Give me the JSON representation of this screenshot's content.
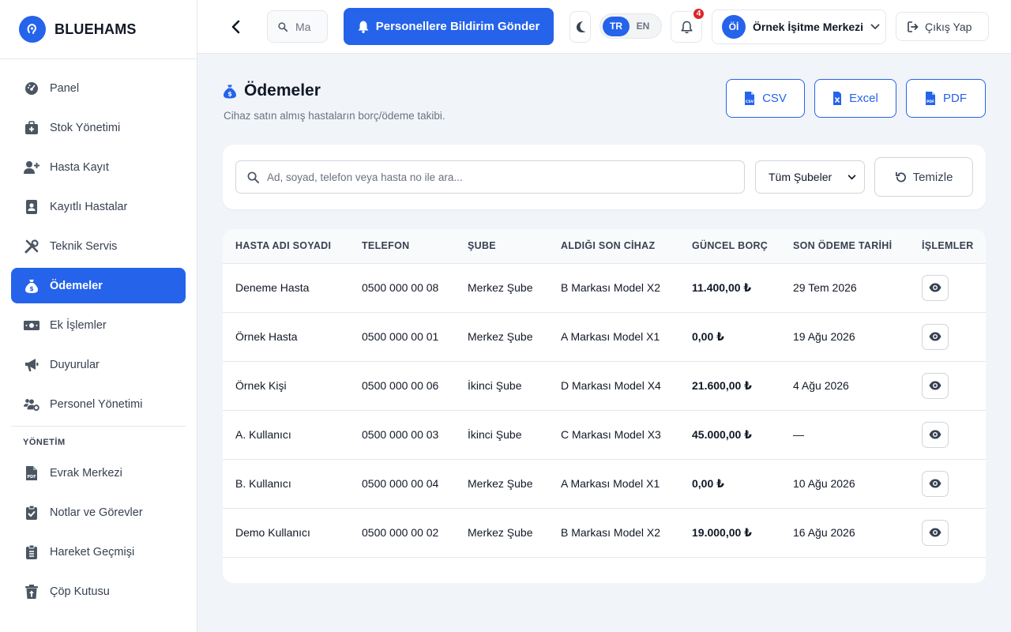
{
  "brand": {
    "name": "BLUEHAMS"
  },
  "sidebar": {
    "items": [
      {
        "label": "Panel",
        "icon": "gauge-icon"
      },
      {
        "label": "Stok Yönetimi",
        "icon": "briefcase-medical-icon"
      },
      {
        "label": "Hasta Kayıt",
        "icon": "user-plus-icon"
      },
      {
        "label": "Kayıtlı Hastalar",
        "icon": "address-book-icon"
      },
      {
        "label": "Teknik Servis",
        "icon": "tools-icon"
      },
      {
        "label": "Ödemeler",
        "icon": "money-bag-icon",
        "active": true
      },
      {
        "label": "Ek İşlemler",
        "icon": "money-bill-icon"
      },
      {
        "label": "Duyurular",
        "icon": "megaphone-icon"
      },
      {
        "label": "Personel Yönetimi",
        "icon": "users-cog-icon"
      }
    ],
    "section_label": "YÖNETİM",
    "admin_items": [
      {
        "label": "Evrak Merkezi",
        "icon": "file-pdf-icon"
      },
      {
        "label": "Notlar ve Görevler",
        "icon": "clipboard-check-icon"
      },
      {
        "label": "Hareket Geçmişi",
        "icon": "clipboard-list-icon"
      },
      {
        "label": "Çöp Kutusu",
        "icon": "trash-restore-icon"
      }
    ]
  },
  "topbar": {
    "search_value": "Ma",
    "notify_label": "Personellere Bildirim Gönder",
    "lang_tr": "TR",
    "lang_en": "EN",
    "notification_count": "4",
    "avatar_initials": "Öİ",
    "user_name": "Örnek İşitme Merkezi",
    "logout_label": "Çıkış Yap"
  },
  "page": {
    "title": "Ödemeler",
    "subtitle": "Cihaz satın almış hastaların borç/ödeme takibi.",
    "export_csv": "CSV",
    "export_excel": "Excel",
    "export_pdf": "PDF"
  },
  "filters": {
    "search_placeholder": "Ad, soyad, telefon veya hasta no ile ara...",
    "branch_selected": "Tüm Şubeler",
    "clear_label": "Temizle"
  },
  "table": {
    "headers": [
      "HASTA ADI SOYADI",
      "TELEFON",
      "ŞUBE",
      "ALDIĞI SON CİHAZ",
      "GÜNCEL BORÇ",
      "SON ÖDEME TARİHİ",
      "İŞLEMLER"
    ],
    "rows": [
      {
        "name": "Deneme Hasta",
        "phone": "0500 000 00 08",
        "branch": "Merkez Şube",
        "device": "B Markası Model X2",
        "debt": "11.400,00 ₺",
        "last_payment": "29 Tem 2026"
      },
      {
        "name": "Örnek Hasta",
        "phone": "0500 000 00 01",
        "branch": "Merkez Şube",
        "device": "A Markası Model X1",
        "debt": "0,00 ₺",
        "last_payment": "19 Ağu 2026"
      },
      {
        "name": "Örnek Kişi",
        "phone": "0500 000 00 06",
        "branch": "İkinci Şube",
        "device": "D Markası Model X4",
        "debt": "21.600,00 ₺",
        "last_payment": "4 Ağu 2026"
      },
      {
        "name": "A. Kullanıcı",
        "phone": "0500 000 00 03",
        "branch": "İkinci Şube",
        "device": "C Markası Model X3",
        "debt": "45.000,00 ₺",
        "last_payment": "—"
      },
      {
        "name": "B. Kullanıcı",
        "phone": "0500 000 00 04",
        "branch": "Merkez Şube",
        "device": "A Markası Model X1",
        "debt": "0,00 ₺",
        "last_payment": "10 Ağu 2026"
      },
      {
        "name": "Demo Kullanıcı",
        "phone": "0500 000 00 02",
        "branch": "Merkez Şube",
        "device": "B Markası Model X2",
        "debt": "19.000,00 ₺",
        "last_payment": "16 Ağu 2026"
      }
    ]
  },
  "colors": {
    "primary": "#2563eb",
    "badge": "#dc2626",
    "background": "#f1f5f9"
  }
}
